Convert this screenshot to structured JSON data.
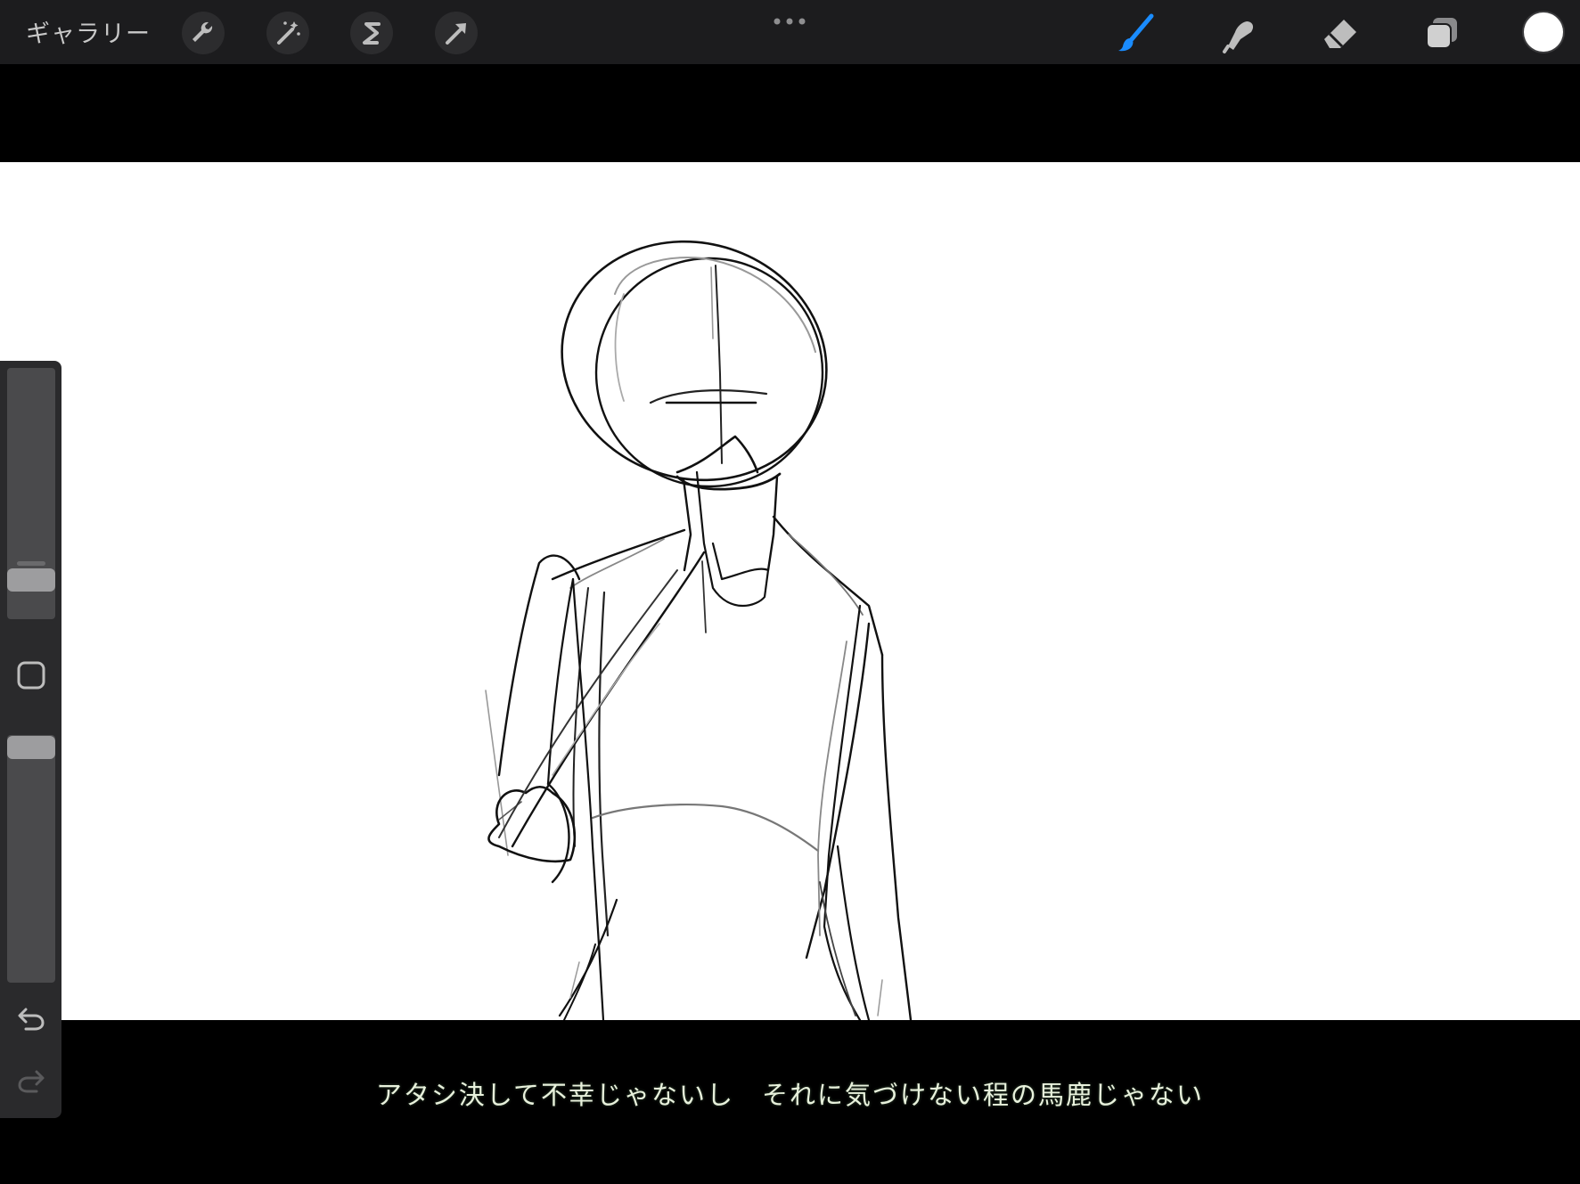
{
  "app": {
    "gallery_label": "ギャラリー"
  },
  "toolbar": {
    "left_tools": [
      {
        "name": "actions",
        "icon": "wrench-icon"
      },
      {
        "name": "adjustments",
        "icon": "magic-wand-icon"
      },
      {
        "name": "selection",
        "icon": "selection-s-icon"
      },
      {
        "name": "transform",
        "icon": "arrow-cursor-icon"
      }
    ],
    "right_tools": [
      {
        "name": "brush",
        "icon": "brush-icon",
        "active": true
      },
      {
        "name": "smudge",
        "icon": "smudge-finger-icon",
        "active": false
      },
      {
        "name": "eraser",
        "icon": "eraser-icon",
        "active": false
      },
      {
        "name": "layers",
        "icon": "layers-icon",
        "active": false
      }
    ],
    "current_color": "#ffffff"
  },
  "sidebar": {
    "brush_size_level": 0.05,
    "brush_opacity_level": 1.0,
    "modify_button": "square-icon",
    "undo_icon": "undo-icon",
    "redo_icon": "redo-icon"
  },
  "subtitle": {
    "text": "アタシ決して不幸じゃないし　それに気づけない程の馬鹿じゃない"
  },
  "colors": {
    "accent": "#1a8cff",
    "toolbar_bg": "#1c1c1e",
    "canvas_bg": "#ffffff"
  }
}
